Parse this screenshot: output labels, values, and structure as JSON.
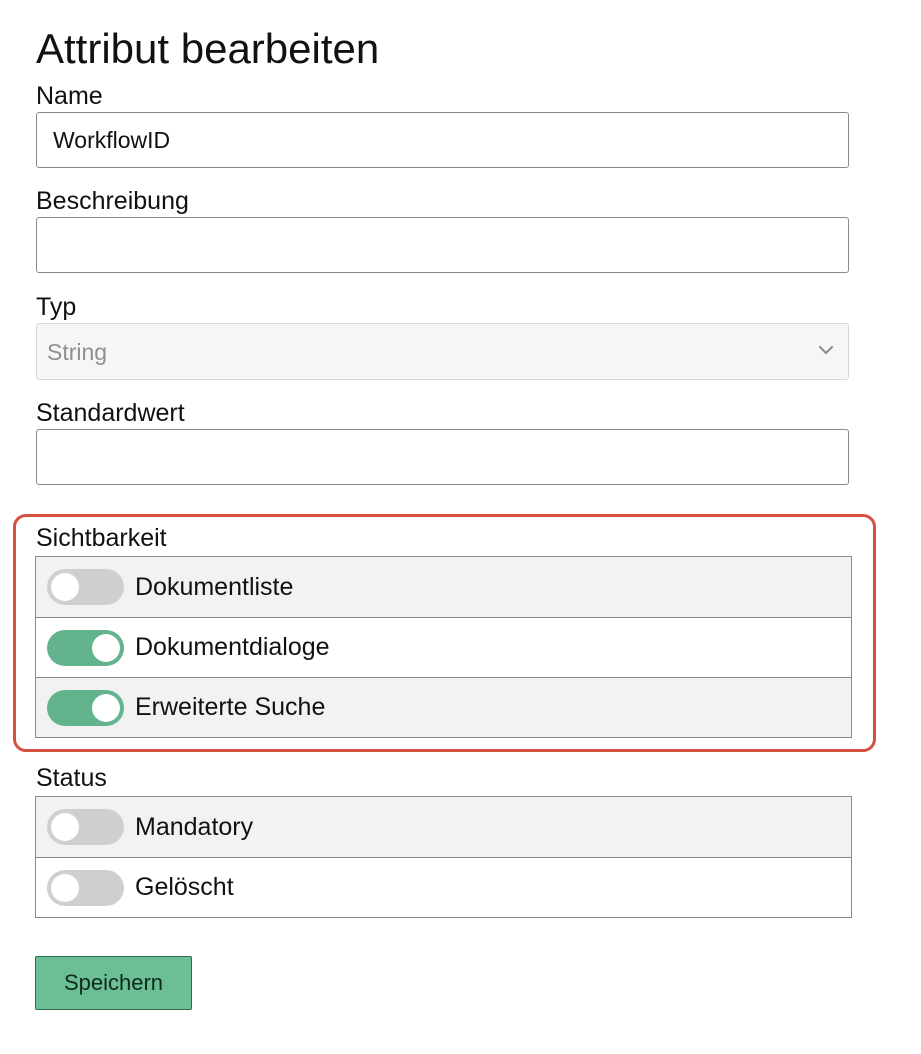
{
  "form": {
    "title": "Attribut bearbeiten",
    "name": {
      "label": "Name",
      "value": "WorkflowID"
    },
    "beschreibung": {
      "label": "Beschreibung",
      "value": ""
    },
    "typ": {
      "label": "Typ",
      "value": "String",
      "disabled": true
    },
    "standardwert": {
      "label": "Standardwert",
      "value": ""
    }
  },
  "sichtbarkeit": {
    "label": "Sichtbarkeit",
    "highlight_color": "#d4503f",
    "items": [
      {
        "label": "Dokumentliste",
        "enabled": false
      },
      {
        "label": "Dokumentdialoge",
        "enabled": true
      },
      {
        "label": "Erweiterte Suche",
        "enabled": true
      }
    ]
  },
  "status": {
    "label": "Status",
    "items": [
      {
        "label": "Mandatory",
        "enabled": false
      },
      {
        "label": "Gelöscht",
        "enabled": false
      }
    ]
  },
  "actions": {
    "save_label": "Speichern"
  },
  "colors": {
    "toggle_on": "#63b38f",
    "toggle_off": "#cfcfcf",
    "button": "#6cbf94"
  }
}
